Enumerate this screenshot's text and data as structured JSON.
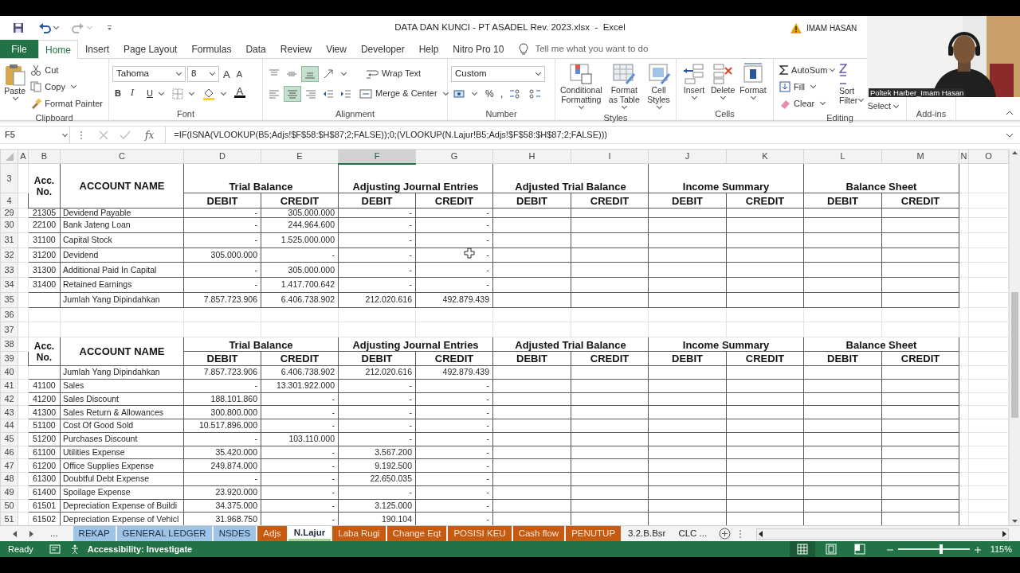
{
  "window": {
    "title": "DATA DAN KUNCI - PT ASADEL Rev. 2023.xlsx  -  Excel",
    "account": "IMAM HASAN"
  },
  "ribbon_tabs": [
    {
      "label": "File",
      "kind": "file",
      "selected": false
    },
    {
      "label": "Home",
      "kind": "tab",
      "selected": true
    },
    {
      "label": "Insert",
      "kind": "tab",
      "selected": false
    },
    {
      "label": "Page Layout",
      "kind": "tab",
      "selected": false
    },
    {
      "label": "Formulas",
      "kind": "tab",
      "selected": false
    },
    {
      "label": "Data",
      "kind": "tab",
      "selected": false
    },
    {
      "label": "Review",
      "kind": "tab",
      "selected": false
    },
    {
      "label": "View",
      "kind": "tab",
      "selected": false
    },
    {
      "label": "Developer",
      "kind": "tab",
      "selected": false
    },
    {
      "label": "Help",
      "kind": "tab",
      "selected": false
    },
    {
      "label": "Nitro Pro 10",
      "kind": "tab",
      "selected": false
    }
  ],
  "tell_me": {
    "placeholder": "Tell me what you want to do"
  },
  "ribbon": {
    "clipboard": {
      "label": "Clipboard",
      "paste": "Paste",
      "cut": "Cut",
      "copy": "Copy",
      "format_painter": "Format Painter"
    },
    "font": {
      "label": "Font",
      "font_name": "Tahoma",
      "font_size": "8",
      "grow_font": "A",
      "shrink_font": "A",
      "bold": "B",
      "italic": "I",
      "underline": "U",
      "font_color": "A"
    },
    "alignment": {
      "label": "Alignment",
      "vertical_buttons": [
        {
          "selected": false
        },
        {
          "selected": false
        },
        {
          "selected": true
        }
      ],
      "horizontal_buttons": [
        {
          "selected": false
        },
        {
          "selected": true
        },
        {
          "selected": false
        }
      ],
      "wrap_text": "Wrap Text",
      "merge_center": "Merge & Center"
    },
    "number": {
      "label": "Number",
      "format": "Custom",
      "percent": "%",
      "comma": ","
    },
    "styles": {
      "label": "Styles",
      "conditional": "Conditional Formatting",
      "format_table": "Format as Table",
      "cell_styles": "Cell Styles"
    },
    "cells": {
      "label": "Cells",
      "insert": "Insert",
      "delete": "Delete",
      "format": "Format"
    },
    "editing": {
      "label": "Editing",
      "autosum": "AutoSum",
      "fill": "Fill",
      "clear": "Clear",
      "sort": "Sort",
      "filter": "Filter",
      "select": "Select"
    },
    "addins": {
      "label": "Add-ins"
    }
  },
  "formula_bar": {
    "name_box": "F5",
    "fx": "fx",
    "formula": "=IF(ISNA(VLOOKUP(B5;Adjs!$F$58:$H$87;2;FALSE));0;(VLOOKUP(N.Lajur!B5;Adjs!$F$58:$H$87;2;FALSE)))"
  },
  "columns": [
    {
      "label": "A",
      "selected": false
    },
    {
      "label": "B",
      "selected": false
    },
    {
      "label": "C",
      "selected": false
    },
    {
      "label": "D",
      "selected": false
    },
    {
      "label": "E",
      "selected": false
    },
    {
      "label": "F",
      "selected": true
    },
    {
      "label": "G",
      "selected": false
    },
    {
      "label": "H",
      "selected": false
    },
    {
      "label": "I",
      "selected": false
    },
    {
      "label": "J",
      "selected": false
    },
    {
      "label": "K",
      "selected": false
    },
    {
      "label": "L",
      "selected": false
    },
    {
      "label": "M",
      "selected": false
    },
    {
      "label": "N",
      "selected": false
    },
    {
      "label": "O",
      "selected": false
    }
  ],
  "rows": [
    {
      "kind": "header",
      "numbers": [
        "3",
        "4"
      ],
      "acc_no": "Acc. No.",
      "account_name": "ACCOUNT NAME",
      "groups": [
        "Trial Balance",
        "Adjusting Journal Entries",
        "Adjusted Trial Balance",
        "Income Summary",
        "Balance Sheet"
      ],
      "subheads": [
        "DEBIT",
        "CREDIT",
        "DEBIT",
        "CREDIT",
        "DEBIT",
        "CREDIT",
        "DEBIT",
        "CREDIT",
        "DEBIT",
        "CREDIT"
      ]
    },
    {
      "kind": "data",
      "number": "29",
      "acc": "21305",
      "name": "Devidend Payable",
      "values": [
        "-",
        "305.000.000",
        "-",
        "-"
      ]
    },
    {
      "kind": "data",
      "number": "30",
      "acc": "22100",
      "name": "Bank Jateng Loan",
      "values": [
        "-",
        "244.964.600",
        "-",
        "-"
      ]
    },
    {
      "kind": "data",
      "number": "31",
      "acc": "31100",
      "name": "Capital Stock",
      "values": [
        "-",
        "1.525.000.000",
        "-",
        "-"
      ]
    },
    {
      "kind": "data",
      "number": "32",
      "acc": "31200",
      "name": "Devidend",
      "values": [
        "305.000.000",
        "-",
        "-",
        "-"
      ]
    },
    {
      "kind": "data",
      "number": "33",
      "acc": "31300",
      "name": "Additional Paid In Capital",
      "values": [
        "-",
        "305.000.000",
        "-",
        "-"
      ]
    },
    {
      "kind": "data",
      "number": "34",
      "acc": "31400",
      "name": "Retained Earnings",
      "values": [
        "-",
        "1.417.700.642",
        "-",
        "-"
      ]
    },
    {
      "kind": "data",
      "number": "35",
      "name": "Jumlah Yang Dipindahkan",
      "values": [
        "7.857.723.906",
        "6.406.738.902",
        "212.020.616",
        "492.879.439"
      ]
    },
    {
      "kind": "blank",
      "number": "36"
    },
    {
      "kind": "blank",
      "number": "37"
    },
    {
      "kind": "header",
      "numbers": [
        "38",
        "39"
      ],
      "acc_no": "Acc. No.",
      "account_name": "ACCOUNT NAME",
      "groups": [
        "Trial Balance",
        "Adjusting Journal Entries",
        "Adjusted Trial Balance",
        "Income Summary",
        "Balance Sheet"
      ],
      "subheads": [
        "DEBIT",
        "CREDIT",
        "DEBIT",
        "CREDIT",
        "DEBIT",
        "CREDIT",
        "DEBIT",
        "CREDIT",
        "DEBIT",
        "CREDIT"
      ]
    },
    {
      "kind": "data",
      "number": "40",
      "name": "Jumlah Yang Dipindahkan",
      "values": [
        "7.857.723.906",
        "6.406.738.902",
        "212.020.616",
        "492.879.439"
      ]
    },
    {
      "kind": "data",
      "number": "41",
      "acc": "41100",
      "name": "Sales",
      "values": [
        "-",
        "13.301.922.000",
        "-",
        "-"
      ]
    },
    {
      "kind": "data",
      "number": "42",
      "acc": "41200",
      "name": "Sales Discount",
      "values": [
        "188.101.860",
        "-",
        "-",
        "-"
      ]
    },
    {
      "kind": "data",
      "number": "43",
      "acc": "41300",
      "name": "Sales Return & Allowances",
      "values": [
        "300.800.000",
        "-",
        "-",
        "-"
      ]
    },
    {
      "kind": "data",
      "number": "44",
      "acc": "51100",
      "name": "Cost Of Good Sold",
      "values": [
        "10.517.896.000",
        "-",
        "-",
        "-"
      ]
    },
    {
      "kind": "data",
      "number": "45",
      "acc": "51200",
      "name": "Purchases Discount",
      "values": [
        "-",
        "103.110.000",
        "-",
        "-"
      ]
    },
    {
      "kind": "data",
      "number": "46",
      "acc": "61100",
      "name": "Utilities Expense",
      "values": [
        "35.420.000",
        "-",
        "3.567.200",
        "-"
      ]
    },
    {
      "kind": "data",
      "number": "47",
      "acc": "61200",
      "name": "Office Supplies Expense",
      "values": [
        "249.874.000",
        "-",
        "9.192.500",
        "-"
      ]
    },
    {
      "kind": "data",
      "number": "48",
      "acc": "61300",
      "name": "Doubtful Debt Expense",
      "values": [
        "-",
        "-",
        "22.650.035",
        "-"
      ]
    },
    {
      "kind": "data",
      "number": "49",
      "acc": "61400",
      "name": "Spoilage Expense",
      "values": [
        "23.920.000",
        "-",
        "-",
        "-"
      ]
    },
    {
      "kind": "data",
      "number": "50",
      "acc": "61501",
      "name": "Depreciation Expense of Buildi",
      "values": [
        "34.375.000",
        "-",
        "3.125.000",
        "-"
      ]
    },
    {
      "kind": "data",
      "number": "51",
      "acc": "61502",
      "name": "Depreciation Expense of Vehicl",
      "values": [
        "31.968.750",
        "-",
        "190.104",
        "-"
      ]
    }
  ],
  "sheet_nav": {
    "more": "..."
  },
  "sheet_tabs": [
    {
      "label": "REKAP",
      "color": "#9dc3e6",
      "selected": false
    },
    {
      "label": "GENERAL LEDGER",
      "color": "#9dc3e6",
      "selected": false
    },
    {
      "label": "NSDES",
      "color": "#9dc3e6",
      "selected": false
    },
    {
      "label": "Adjs",
      "color": "#c55a11",
      "selected": false
    },
    {
      "label": "N.Lajur",
      "color": "#a9d18e",
      "selected": true
    },
    {
      "label": "Laba Rugi",
      "color": "#c55a11",
      "selected": false
    },
    {
      "label": "Change Eqt",
      "color": "#c55a11",
      "selected": false
    },
    {
      "label": "POSISI KEU",
      "color": "#c55a11",
      "selected": false
    },
    {
      "label": "Cash flow",
      "color": "#c55a11",
      "selected": false
    },
    {
      "label": "PENUTUP",
      "color": "#c55a11",
      "selected": false
    },
    {
      "label": "3.2.B.Bsr",
      "selected": false
    },
    {
      "label": "CLC ...",
      "selected": false
    }
  ],
  "status_bar": {
    "mode": "Ready",
    "accessibility": "Accessibility: Investigate",
    "views": [
      {
        "kind": "normal",
        "selected": true
      },
      {
        "kind": "page_layout",
        "selected": false
      },
      {
        "kind": "page_break",
        "selected": false
      }
    ],
    "zoom_level": {
      "level": 0.6
    },
    "zoom": "115%"
  },
  "video": {
    "kind": "picture",
    "caption": "Poltek Harber_Imam Hasan"
  }
}
